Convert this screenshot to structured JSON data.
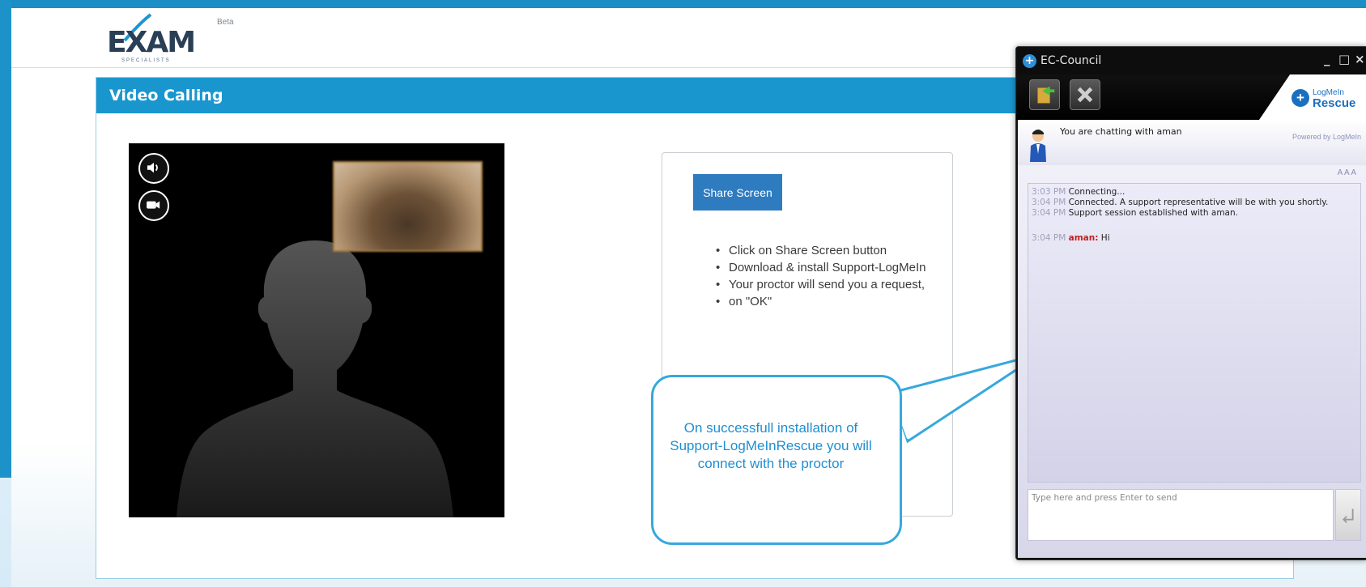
{
  "logo": {
    "word": "EXAM",
    "sub": "SPECIALISTS",
    "beta": "Beta"
  },
  "panel": {
    "title": "Video Calling"
  },
  "info": {
    "share_label": "Share Screen",
    "steps": [
      "Click on Share Screen button",
      "Download & install Support-LogMeIn",
      "Your proctor will send you a request,",
      "on \"OK\""
    ]
  },
  "callout": {
    "text": "On successfull installation of Support-LogMeInRescue you will connect with the proctor"
  },
  "chat": {
    "window_title": "EC-Council",
    "min": "_",
    "max": "□",
    "close": "×",
    "brand_top": "LogMeIn",
    "brand_bottom": "Rescue",
    "chatting_with": "You are chatting with aman",
    "powered_by": "Powered by LogMeIn",
    "font_ctrl": "A A A",
    "messages": [
      {
        "time": "3:03 PM",
        "text": "Connecting..."
      },
      {
        "time": "3:04 PM",
        "text": "Connected. A support representative will be with you shortly."
      },
      {
        "time": "3:04 PM",
        "text": "Support session established with aman."
      },
      {
        "time": "3:04 PM",
        "sender": "aman:",
        "text": "Hi"
      }
    ],
    "input_placeholder": "Type here and press Enter to send"
  },
  "colors": {
    "header_bar": "#1a96cf",
    "share_button": "#2f7bbf",
    "callout_text": "#1f8fd1",
    "sender_name": "#c41e1e"
  }
}
